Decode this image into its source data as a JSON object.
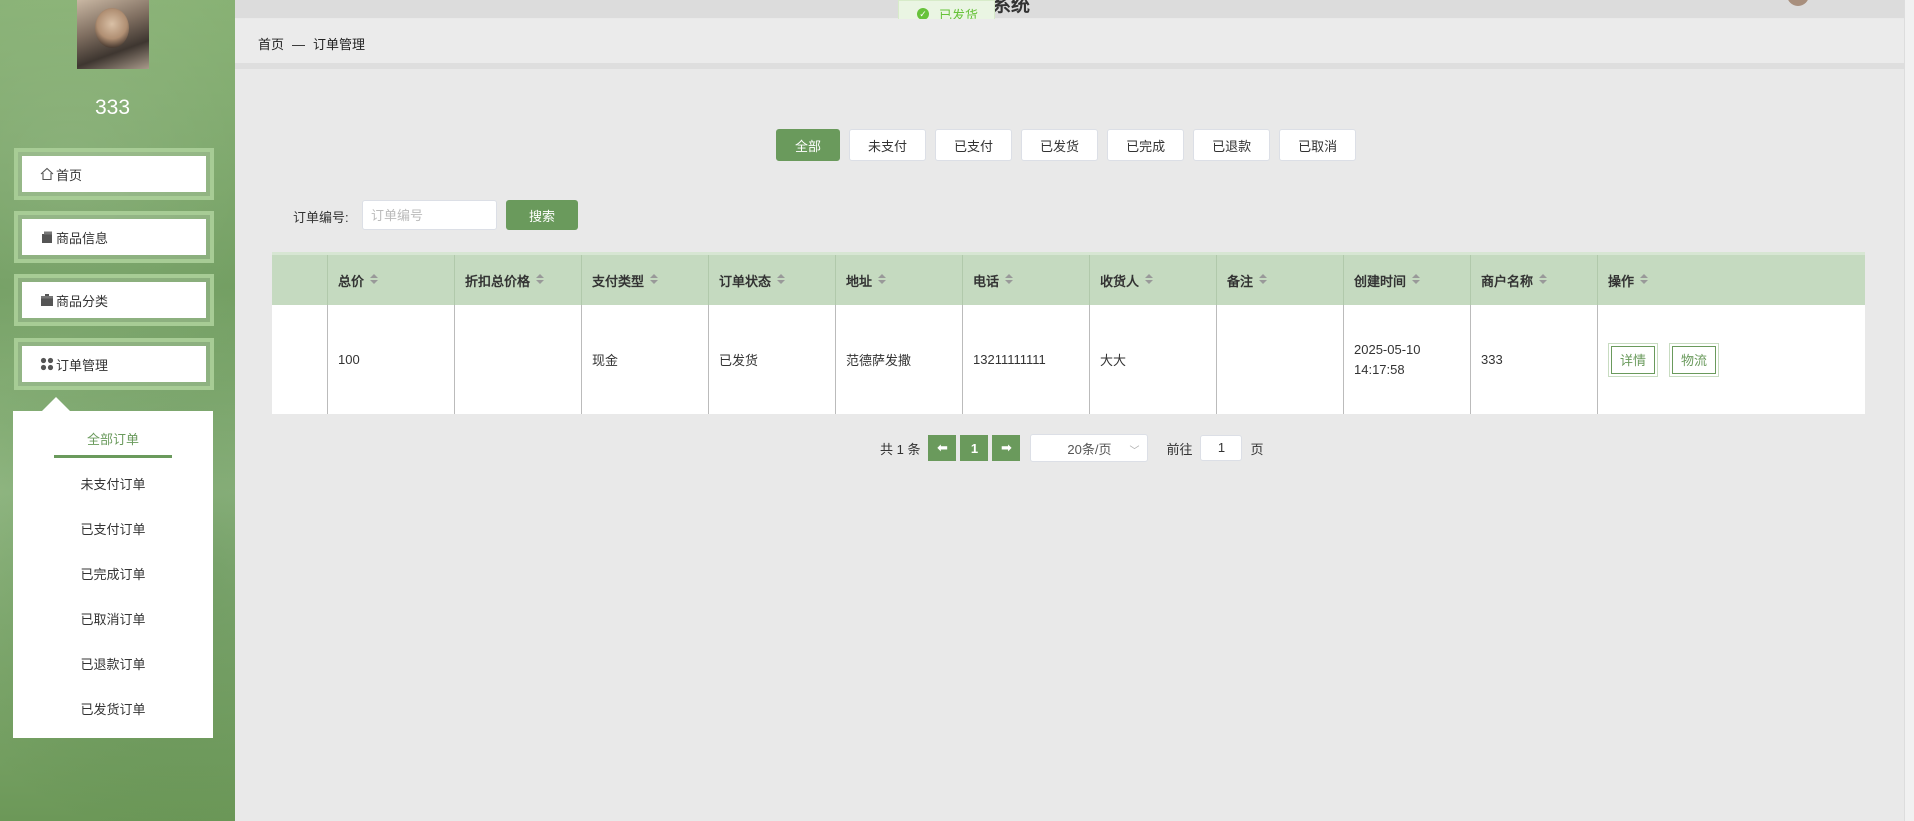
{
  "header": {
    "title_fragment": "系统",
    "toast": "已发货"
  },
  "user": {
    "name": "333"
  },
  "sidebar": {
    "items": [
      {
        "label": "首页",
        "icon": "home-icon"
      },
      {
        "label": "商品信息",
        "icon": "package-icon"
      },
      {
        "label": "商品分类",
        "icon": "category-icon"
      },
      {
        "label": "订单管理",
        "icon": "grid-icon"
      }
    ],
    "submenu": [
      "全部订单",
      "未支付订单",
      "已支付订单",
      "已完成订单",
      "已取消订单",
      "已退款订单",
      "已发货订单"
    ]
  },
  "breadcrumb": {
    "home": "首页",
    "sep": "—",
    "current": "订单管理"
  },
  "filters": [
    "全部",
    "未支付",
    "已支付",
    "已发货",
    "已完成",
    "已退款",
    "已取消"
  ],
  "search": {
    "label": "订单编号:",
    "placeholder": "订单编号",
    "button": "搜索"
  },
  "table": {
    "headers": [
      "总价",
      "折扣总价格",
      "支付类型",
      "订单状态",
      "地址",
      "电话",
      "收货人",
      "备注",
      "创建时间",
      "商户名称",
      "操作"
    ],
    "rows": [
      {
        "total": "100",
        "discount": "",
        "pay_type": "现金",
        "status": "已发货",
        "address": "范德萨发撒",
        "phone": "13211111111",
        "receiver": "大大",
        "remark": "",
        "created": "2025-05-10 14:17:58",
        "merchant": "333",
        "actions": [
          "详情",
          "物流"
        ]
      }
    ]
  },
  "pagination": {
    "total_text": "共 1 条",
    "prev": "⬅",
    "page": "1",
    "next": "➡",
    "page_size": "20条/页",
    "goto_label": "前往",
    "goto_value": "1",
    "page_unit": "页"
  },
  "colors": {
    "accent": "#6a9a5c",
    "header_row": "#c5dac0",
    "toast": "#67c23a"
  }
}
